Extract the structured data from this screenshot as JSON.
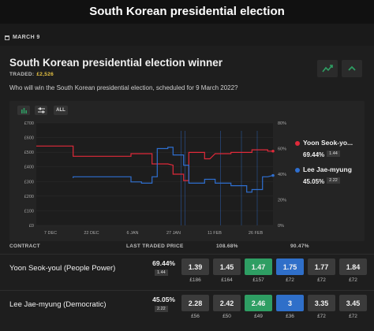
{
  "page": {
    "title": "South Korean presidential election"
  },
  "date_label": "MARCH 9",
  "market": {
    "title": "South Korean presidential election winner",
    "traded_label": "TRADED:",
    "traded_amount": "£2,526",
    "question": "Who will win the South Korean presidential election, scheduled for 9 March 2022?",
    "icons": [
      "chart-icon",
      "chevron-up-icon"
    ]
  },
  "chart_controls": [
    "bar-chart-icon",
    "sliders-icon",
    "ALL"
  ],
  "chart_data": {
    "type": "line",
    "left_axis": {
      "ticks": [
        "£700",
        "£600",
        "£500",
        "£400",
        "£300",
        "£200",
        "£100",
        "£0"
      ],
      "ylim": [
        0,
        700
      ]
    },
    "right_axis": {
      "ticks": [
        "80%",
        "60%",
        "40%",
        "20%",
        "0%"
      ],
      "ylim": [
        0,
        80
      ]
    },
    "x_ticks": [
      "7 DEC",
      "22 DEC",
      "6 JAN",
      "27 JAN",
      "11 FEB",
      "26 FEB"
    ],
    "x_range": [
      0,
      90
    ],
    "series": [
      {
        "name": "Yoon Seok-youl",
        "color": "#e02a3a",
        "points": [
          [
            0,
            62
          ],
          [
            4,
            62
          ],
          [
            14,
            62
          ],
          [
            14,
            54
          ],
          [
            32,
            54
          ],
          [
            36,
            54
          ],
          [
            36,
            56
          ],
          [
            40,
            56
          ],
          [
            44,
            56
          ],
          [
            44,
            48
          ],
          [
            46,
            48
          ],
          [
            50,
            48
          ],
          [
            52,
            47
          ],
          [
            52,
            40
          ],
          [
            54,
            40
          ],
          [
            56,
            40
          ],
          [
            56,
            35
          ],
          [
            58,
            35
          ],
          [
            58,
            57
          ],
          [
            62,
            57
          ],
          [
            64,
            57
          ],
          [
            64,
            52
          ],
          [
            66,
            52
          ],
          [
            68,
            56
          ],
          [
            74,
            56
          ],
          [
            74,
            57
          ],
          [
            82,
            57
          ],
          [
            82,
            59
          ],
          [
            86,
            59
          ],
          [
            88,
            59
          ],
          [
            88,
            58
          ],
          [
            90,
            58
          ]
        ]
      },
      {
        "name": "Lee Jae-myung",
        "color": "#2f6fd0",
        "points": [
          [
            14,
            37
          ],
          [
            14,
            38
          ],
          [
            32,
            38
          ],
          [
            36,
            38
          ],
          [
            36,
            34
          ],
          [
            40,
            34
          ],
          [
            40,
            33
          ],
          [
            44,
            33
          ],
          [
            44,
            38
          ],
          [
            46,
            38
          ],
          [
            46,
            60
          ],
          [
            50,
            60
          ],
          [
            50,
            61
          ],
          [
            52,
            61
          ],
          [
            52,
            55
          ],
          [
            54,
            55
          ],
          [
            56,
            55
          ],
          [
            56,
            47
          ],
          [
            58,
            47
          ],
          [
            58,
            33
          ],
          [
            62,
            33
          ],
          [
            64,
            33
          ],
          [
            64,
            36
          ],
          [
            68,
            36
          ],
          [
            68,
            33
          ],
          [
            70,
            33
          ],
          [
            74,
            33
          ],
          [
            74,
            31
          ],
          [
            80,
            31
          ],
          [
            80,
            26
          ],
          [
            82,
            26
          ],
          [
            82,
            28
          ],
          [
            84,
            28
          ],
          [
            86,
            28
          ],
          [
            86,
            38
          ],
          [
            88,
            38
          ],
          [
            90,
            39
          ]
        ]
      }
    ]
  },
  "legend": [
    {
      "name": "Yoon Seok-yo...",
      "value": "69.44%",
      "badge": "1.44",
      "color": "#e02a3a"
    },
    {
      "name": "Lee Jae-myung",
      "value": "45.05%",
      "badge": "2.22",
      "color": "#2f6fd0"
    }
  ],
  "table": {
    "headers": {
      "contract": "CONTRACT",
      "last_traded": "LAST TRADED PRICE",
      "back_overround": "108.68%",
      "lay_overround": "90.47%"
    },
    "rows": [
      {
        "name": "Yoon Seok-youl (People Power)",
        "pct": "69.44%",
        "badge": "1.44",
        "prices": [
          {
            "p": "1.39",
            "v": "£186",
            "kind": "grey"
          },
          {
            "p": "1.45",
            "v": "£164",
            "kind": "grey"
          },
          {
            "p": "1.47",
            "v": "£157",
            "kind": "green"
          },
          {
            "p": "1.75",
            "v": "£72",
            "kind": "blue"
          },
          {
            "p": "1.77",
            "v": "£72",
            "kind": "grey"
          },
          {
            "p": "1.84",
            "v": "£72",
            "kind": "grey"
          }
        ]
      },
      {
        "name": "Lee Jae-myung (Democratic)",
        "pct": "45.05%",
        "badge": "2.22",
        "prices": [
          {
            "p": "2.28",
            "v": "£56",
            "kind": "grey"
          },
          {
            "p": "2.42",
            "v": "£50",
            "kind": "grey"
          },
          {
            "p": "2.46",
            "v": "£49",
            "kind": "green"
          },
          {
            "p": "3",
            "v": "£36",
            "kind": "blue"
          },
          {
            "p": "3.35",
            "v": "£72",
            "kind": "grey"
          },
          {
            "p": "3.45",
            "v": "£72",
            "kind": "grey"
          }
        ]
      }
    ]
  }
}
